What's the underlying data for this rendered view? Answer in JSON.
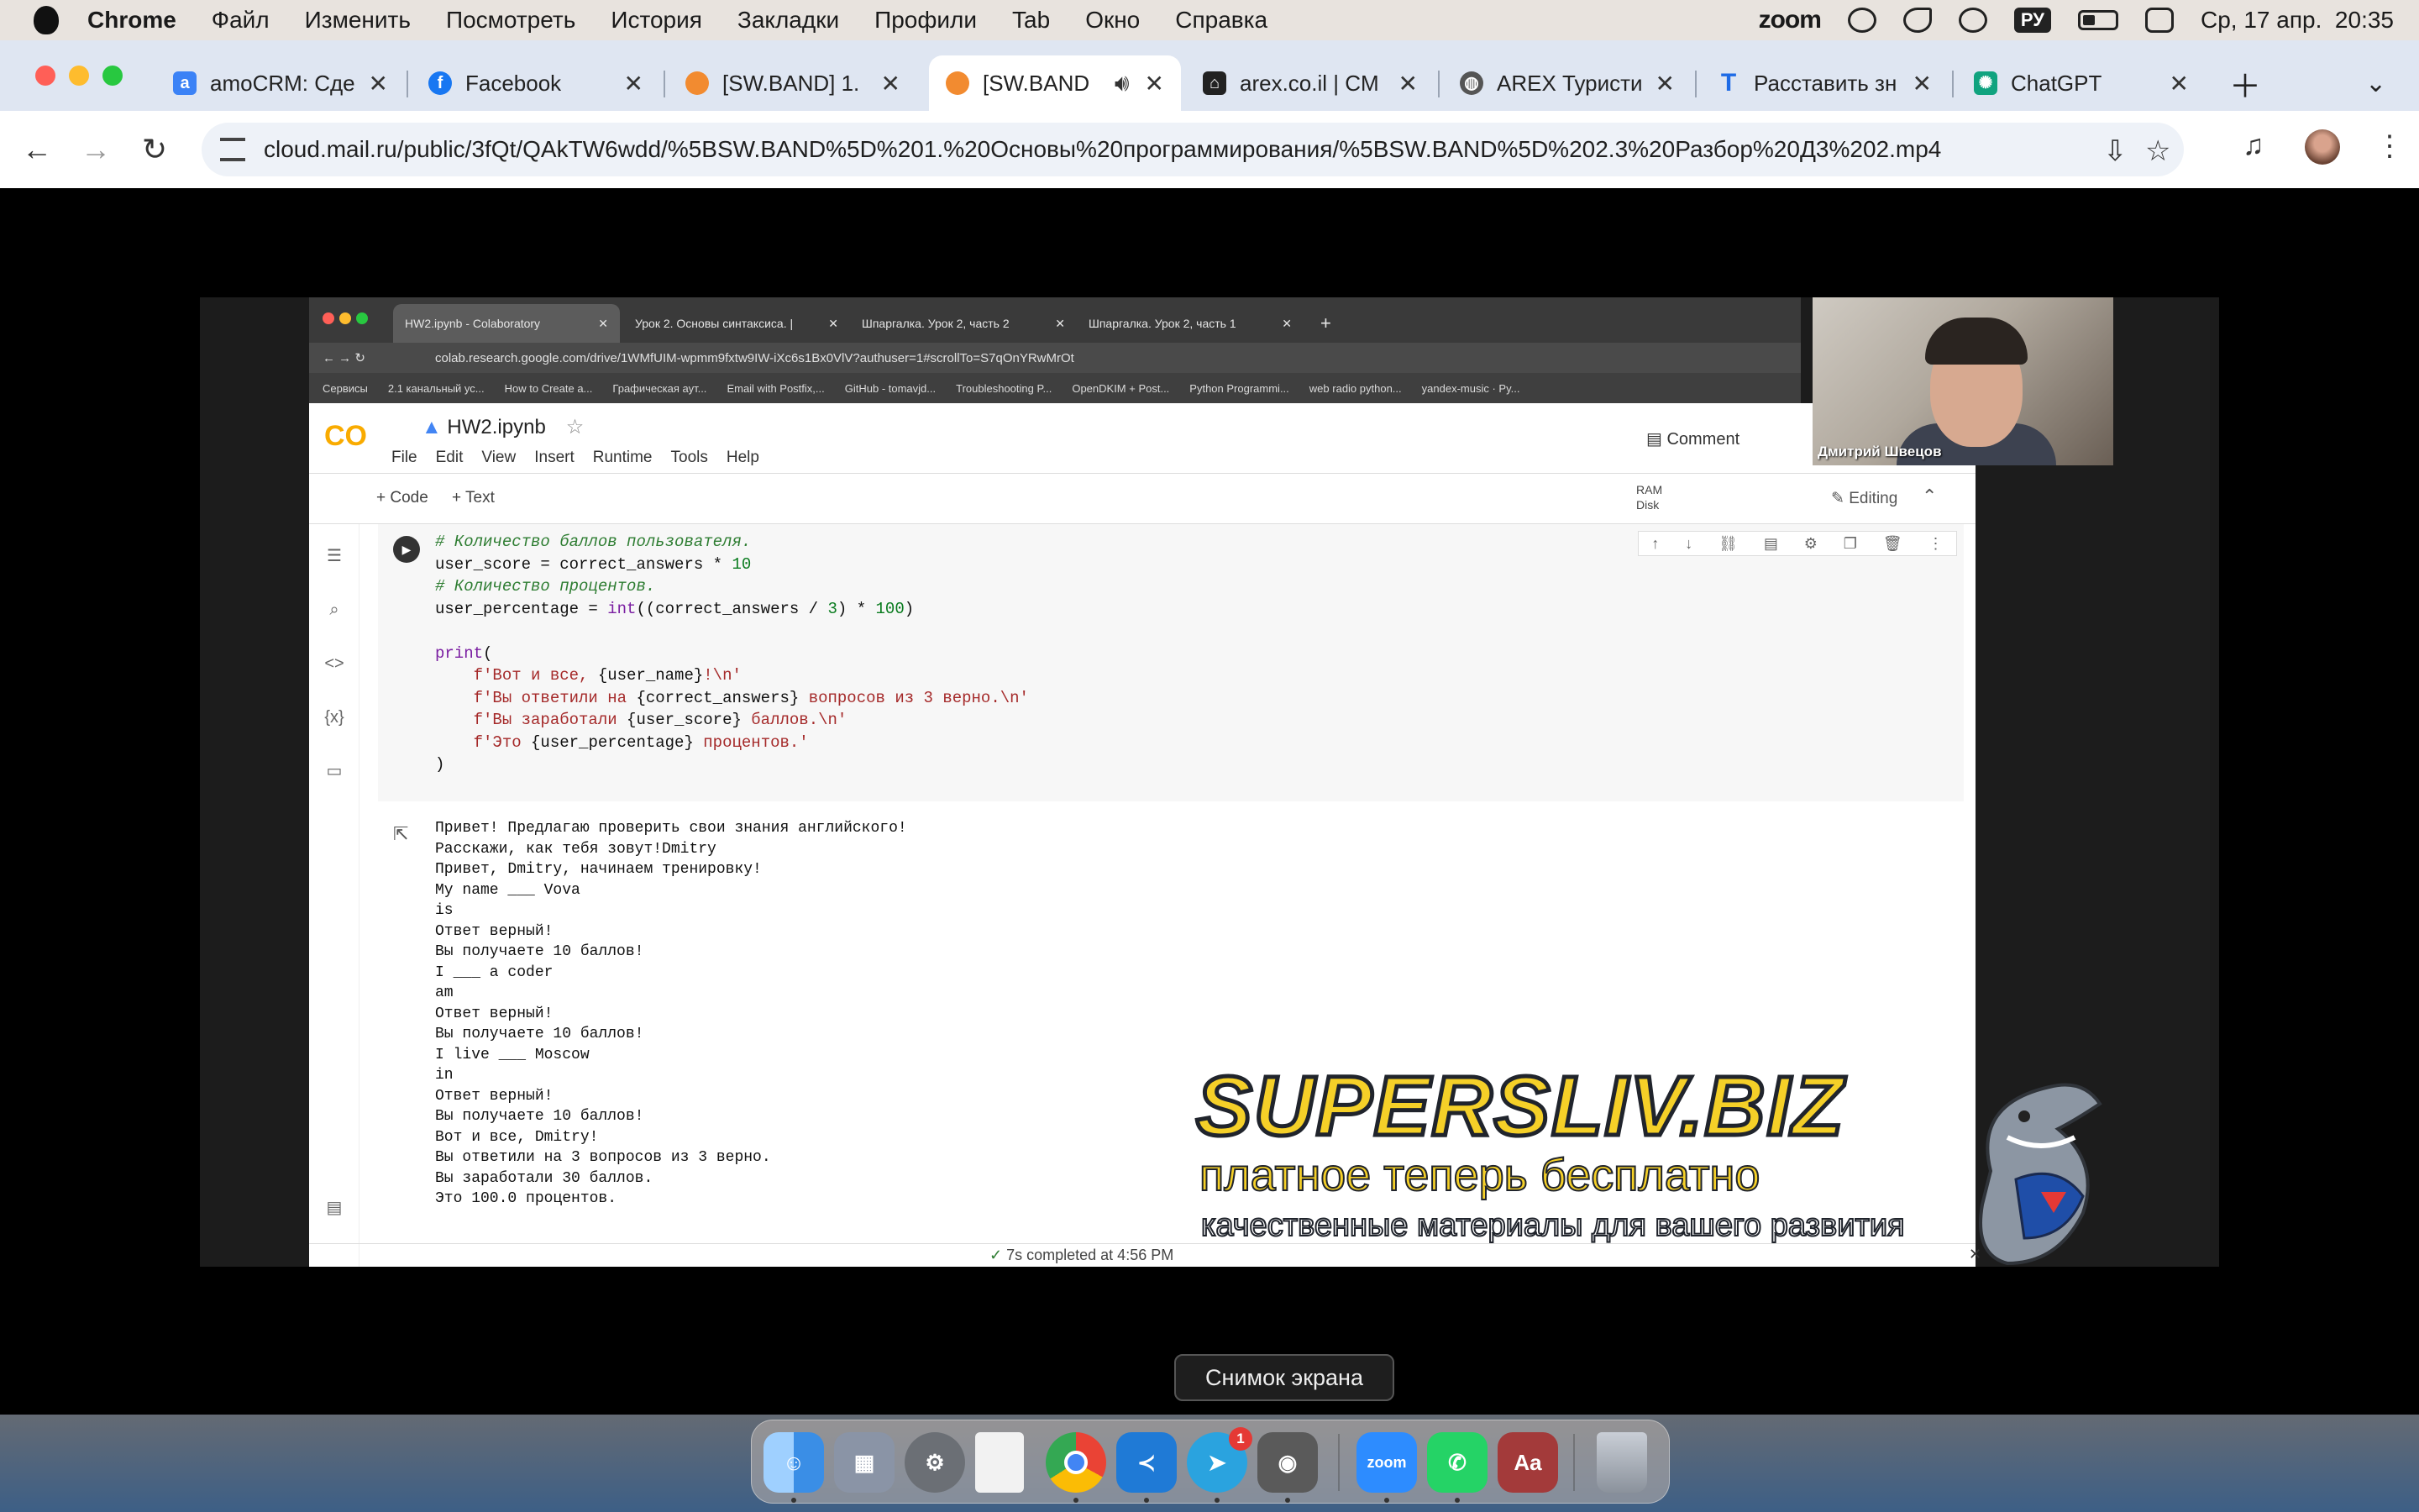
{
  "menubar": {
    "app_name": "Chrome",
    "items": [
      "Файл",
      "Изменить",
      "Посмотреть",
      "История",
      "Закладки",
      "Профили",
      "Tab",
      "Окно",
      "Справка"
    ],
    "zoom_label": "zoom",
    "input_lang": "РУ",
    "datetime": "Ср, 17 апр.  20:35"
  },
  "browser": {
    "tabs": [
      {
        "title": "amoCRM: Сде",
        "icon": "amocrm-icon",
        "color": "#3b82f6",
        "glyph": "a"
      },
      {
        "title": "Facebook",
        "icon": "facebook-icon",
        "color": "#1877f2",
        "glyph": "f"
      },
      {
        "title": "[SW.BAND] 1.",
        "icon": "cloud-mail-icon",
        "color": "#f28b30",
        "glyph": ""
      },
      {
        "title": "[SW.BAND",
        "icon": "cloud-mail-icon",
        "color": "#f28b30",
        "glyph": ""
      },
      {
        "title": "arex.co.il | CM",
        "icon": "arex-icon",
        "color": "#222222",
        "glyph": "⌂"
      },
      {
        "title": "AREX Туристи",
        "icon": "globe-icon",
        "color": "#555555",
        "glyph": "◍"
      },
      {
        "title": "Расставить зн",
        "icon": "text-t-icon",
        "color": "#1e6be6",
        "glyph": "T"
      },
      {
        "title": "ChatGPT",
        "icon": "chatgpt-icon",
        "color": "#10a37f",
        "glyph": "✺"
      }
    ],
    "url": "cloud.mail.ru/public/3fQt/QAkTW6wdd/%5BSW.BAND%5D%201.%20Основы%20программирования/%5BSW.BAND%5D%202.3%20Разбор%20Д3%202.mp4"
  },
  "video": {
    "tabs": [
      "HW2.ipynb - Colaboratory",
      "Урок 2. Основы синтаксиса. |",
      "Шпаргалка. Урок 2, часть 2",
      "Шпаргалка. Урок 2, часть 1"
    ],
    "url": "colab.research.google.com/drive/1WMfUIM-wpmm9fxtw9IW-iXc6s1Bx0VlV?authuser=1#scrollTo=S7qOnYRwMrOt",
    "bookmarks": [
      "Сервисы",
      "2.1 канальный ус...",
      "How to Create a...",
      "Графическая аут...",
      "Email with Postfix,...",
      "GitHub - tomavjd...",
      "Troubleshooting P...",
      "OpenDKIM + Post...",
      "Python Programmi...",
      "web radio python...",
      "yandex-music · Py..."
    ],
    "notebook_title": "HW2.ipynb",
    "notebook_menu": [
      "File",
      "Edit",
      "View",
      "Insert",
      "Runtime",
      "Tools",
      "Help"
    ],
    "comment_label": "Comment",
    "add_code": "+ Code",
    "add_text": "+ Text",
    "ram_label": "RAM",
    "disk_label": "Disk",
    "editing_label": "Editing",
    "status_time": "7s",
    "status_text": "completed at 4:56 PM",
    "webcam_name": "Дмитрий Швецов"
  },
  "watermark": {
    "line1": "SUPERSLIV.BIZ",
    "line2": "платное теперь бесплатно",
    "line3": "качественные материалы для вашего развития"
  },
  "tooltip": "Снимок экрана",
  "dock": {
    "telegram_badge": "1",
    "apps": [
      {
        "name": "finder-icon",
        "color": "#3a8ee6"
      },
      {
        "name": "launchpad-icon",
        "color": "#8a94a6"
      },
      {
        "name": "system-settings-icon",
        "color": "#6b6f75"
      },
      {
        "name": "file-icon",
        "color": "#f2f2f2"
      },
      {
        "name": "chrome-icon",
        "color": "#e8e8e8"
      },
      {
        "name": "vscode-icon",
        "color": "#1f7ad6"
      },
      {
        "name": "telegram-icon",
        "color": "#2aa3df"
      },
      {
        "name": "screenshot-icon",
        "color": "#5a5a5a"
      },
      {
        "name": "zoom-icon",
        "color": "#2d8cff"
      },
      {
        "name": "whatsapp-icon",
        "color": "#25d366"
      },
      {
        "name": "dictionary-icon",
        "color": "#a33a3a"
      },
      {
        "name": "trash-icon",
        "color": "#9aa0a8"
      }
    ]
  }
}
